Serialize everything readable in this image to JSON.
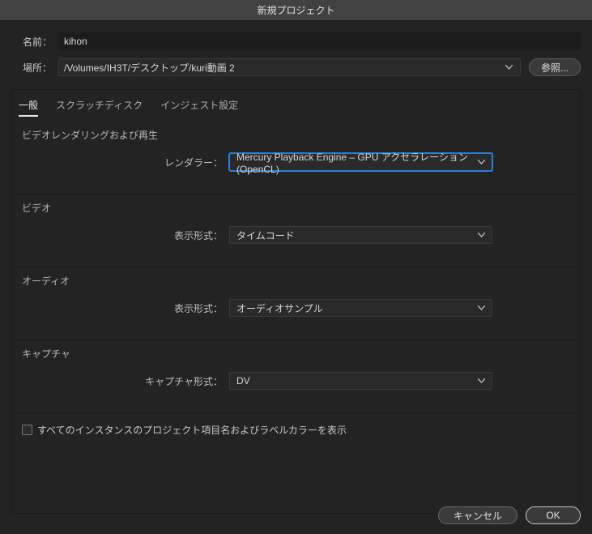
{
  "title": "新規プロジェクト",
  "fields": {
    "name_label": "名前：",
    "name_value": "kihon",
    "location_label": "場所：",
    "location_value": "/Volumes/IH3T/デスクトップ/kuri動画 2",
    "browse": "参照..."
  },
  "tabs": {
    "general": "一般",
    "scratch": "スクラッチディスク",
    "ingest": "インジェスト設定"
  },
  "sections": {
    "render": {
      "title": "ビデオレンダリングおよび再生",
      "label": "レンダラー：",
      "value": "Mercury Playback Engine – GPU アクセラレーション (OpenCL)"
    },
    "video": {
      "title": "ビデオ",
      "label": "表示形式：",
      "value": "タイムコード"
    },
    "audio": {
      "title": "オーディオ",
      "label": "表示形式：",
      "value": "オーディオサンプル"
    },
    "capture": {
      "title": "キャプチャ",
      "label": "キャプチャ形式：",
      "value": "DV"
    }
  },
  "checkbox_label": "すべてのインスタンスのプロジェクト項目名およびラベルカラーを表示",
  "buttons": {
    "cancel": "キャンセル",
    "ok": "OK"
  }
}
